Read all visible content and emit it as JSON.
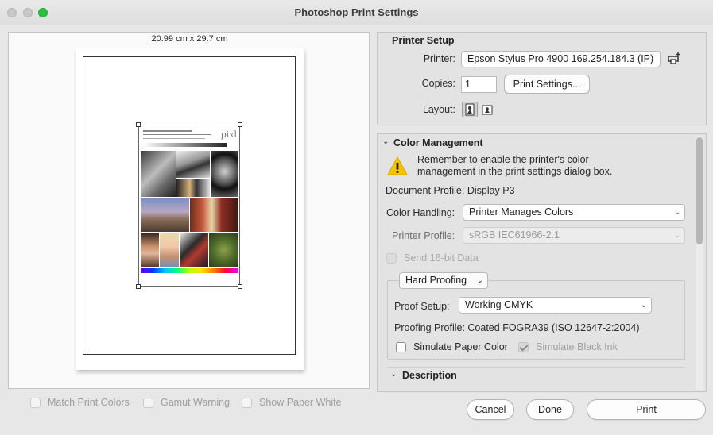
{
  "window": {
    "title": "Photoshop Print Settings"
  },
  "preview": {
    "paper_size": "20.99 cm x 29.7 cm",
    "image_logo": "pixl"
  },
  "bottom_options": {
    "match_print_colors": "Match Print Colors",
    "gamut_warning": "Gamut Warning",
    "show_paper_white": "Show Paper White"
  },
  "printer_setup": {
    "heading": "Printer Setup",
    "printer_label": "Printer:",
    "printer_value": "Epson Stylus Pro 4900 169.254.184.3 (IP)",
    "copies_label": "Copies:",
    "copies_value": "1",
    "print_settings_button": "Print Settings...",
    "layout_label": "Layout:",
    "icons": [
      "printer-add-icon",
      "portrait-orientation-icon",
      "landscape-orientation-icon"
    ]
  },
  "color_management": {
    "heading": "Color Management",
    "warning_line1": "Remember to enable the printer's color",
    "warning_line2": "management in the print settings dialog box.",
    "document_profile": "Document Profile: Display P3",
    "color_handling_label": "Color Handling:",
    "color_handling_value": "Printer Manages Colors",
    "printer_profile_label": "Printer Profile:",
    "printer_profile_value": "sRGB IEC61966-2.1",
    "send_16bit": "Send 16-bit Data",
    "proofing_mode": "Hard Proofing",
    "proof_setup_label": "Proof Setup:",
    "proof_setup_value": "Working CMYK",
    "proofing_profile": "Proofing Profile: Coated FOGRA39 (ISO 12647-2:2004)",
    "simulate_paper_color": "Simulate Paper Color",
    "simulate_black_ink": "Simulate Black Ink",
    "description_heading": "Description"
  },
  "buttons": {
    "cancel": "Cancel",
    "done": "Done",
    "print": "Print"
  },
  "colors": {
    "accent_green": "#2cc240",
    "warning_yellow": "#f5c300"
  }
}
